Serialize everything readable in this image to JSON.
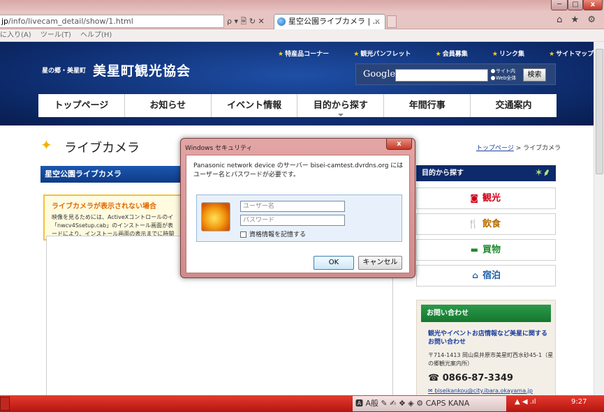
{
  "browser": {
    "url_prefix": "jp",
    "url_path": "/info/livecam_detail/show/1.html",
    "url_controls": "ρ ▾ 🗎 ↻ ✕",
    "tab_title": "星空公園ライブカメラ | ...",
    "tab_close": "×",
    "window_min": "─",
    "window_max": "□",
    "window_close": "x",
    "chrome_icons": "⌂ ★ ⚙"
  },
  "menubar": {
    "items": [
      "に入り(A)",
      "ツール(T)",
      "ヘルプ(H)"
    ]
  },
  "header": {
    "top_links": [
      "特産品コーナー",
      "観光パンフレット",
      "会員募集",
      "リンク集",
      "サイトマップ"
    ],
    "site_subtitle": "星の郷・美星町",
    "site_title": "美星町観光協会",
    "google_label": "Google",
    "radio_site": "サイト内",
    "radio_web": "Web全体",
    "search_button": "検索"
  },
  "nav": {
    "items": [
      "トップページ",
      "お知らせ",
      "イベント情報",
      "目的から探す",
      "年間行事",
      "交通案内"
    ]
  },
  "page": {
    "title": "ライブカメラ",
    "breadcrumb_link": "トップページ",
    "breadcrumb_sep": " > ",
    "breadcrumb_current": "ライブカメラ",
    "section_title": "星空公園ライブカメラ",
    "warning_title": "ライブカメラが表示されない場合",
    "warning_line1": "映像を見るためには、ActiveXコントロールのイ",
    "warning_line2": "「nwcv4Ssetup.cab」のインストール画面が表",
    "warning_line3": "ードにより、インストール画面の表示までに時間"
  },
  "sidebar": {
    "heading": "目的から探す",
    "items": [
      "観光",
      "飲食",
      "買物",
      "宿泊"
    ],
    "contact_heading": "お問い合わせ",
    "contact_link": "観光やイベントお店情報など美星に関するお問い合わせ",
    "contact_address": "〒714-1413 岡山県井原市美星町西水砂45-1（星の郷観光案内所）",
    "contact_phone": "0866-87-3349",
    "contact_email": "biseikankou@city.ibara.okayama.jp"
  },
  "dialog": {
    "title": "Windows セキュリティ",
    "close": "x",
    "message": "Panasonic network device のサーバー bisei-camtest.dvrdns.org にはユーザー名とパスワードが必要です。",
    "username_placeholder": "ユーザー名",
    "password_placeholder": "パスワード",
    "remember_label": "資格情報を記憶する",
    "ok_label": "OK",
    "cancel_label": "キャンセル"
  },
  "taskbar": {
    "ime": "🅰 A般 ✎ ✍ ❖ ◈ ⚙ CAPS KANA",
    "tray": "▲  ◀  .ıl",
    "clock": "9:27"
  }
}
